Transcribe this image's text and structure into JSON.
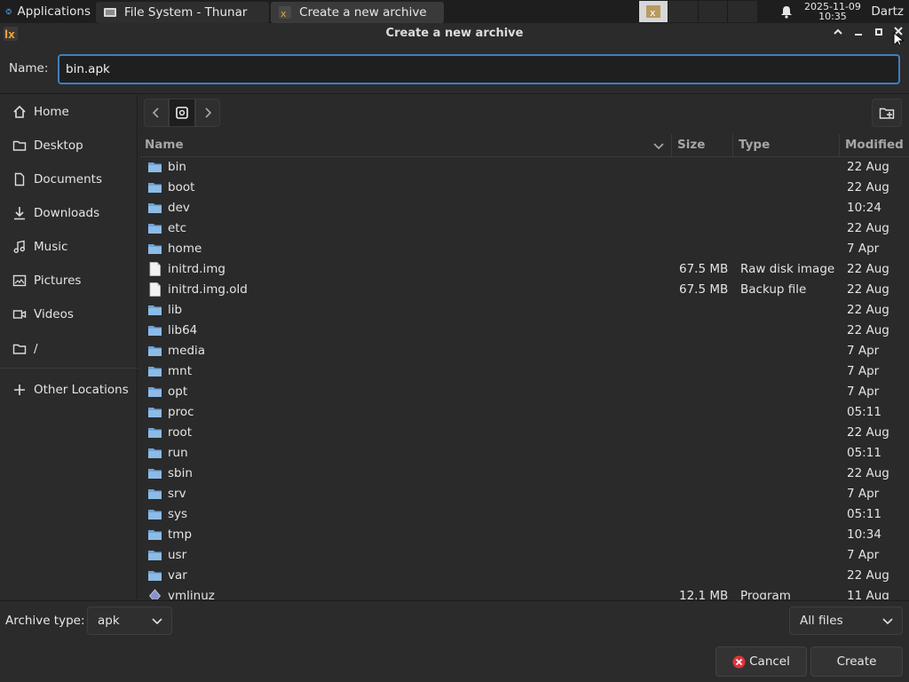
{
  "panel": {
    "applications_label": "Applications",
    "tasks": [
      {
        "label": "File System - Thunar"
      },
      {
        "label": "Create a new archive"
      }
    ],
    "clock_date": "2025-11-09",
    "clock_time": "10:35",
    "user": "Dartz"
  },
  "dialog": {
    "title": "Create a new archive",
    "name_label": "Name:",
    "name_value": "bin.apk"
  },
  "sidebar": {
    "items": [
      {
        "label": "Home",
        "icon": "home-icon"
      },
      {
        "label": "Desktop",
        "icon": "folder-icon"
      },
      {
        "label": "Documents",
        "icon": "document-icon"
      },
      {
        "label": "Downloads",
        "icon": "download-icon"
      },
      {
        "label": "Music",
        "icon": "music-icon"
      },
      {
        "label": "Pictures",
        "icon": "picture-icon"
      },
      {
        "label": "Videos",
        "icon": "video-icon"
      },
      {
        "label": "/",
        "icon": "folder-icon"
      },
      {
        "label": "Other Locations",
        "icon": "plus-icon"
      }
    ]
  },
  "columns": {
    "name": "Name",
    "size": "Size",
    "type": "Type",
    "modified": "Modified"
  },
  "files": [
    {
      "name": "bin",
      "kind": "folder",
      "size": "",
      "type": "",
      "modified": "22 Aug"
    },
    {
      "name": "boot",
      "kind": "folder",
      "size": "",
      "type": "",
      "modified": "22 Aug"
    },
    {
      "name": "dev",
      "kind": "folder",
      "size": "",
      "type": "",
      "modified": "10:24"
    },
    {
      "name": "etc",
      "kind": "folder",
      "size": "",
      "type": "",
      "modified": "22 Aug"
    },
    {
      "name": "home",
      "kind": "folder",
      "size": "",
      "type": "",
      "modified": "7 Apr"
    },
    {
      "name": "initrd.img",
      "kind": "file",
      "size": "67.5 MB",
      "type": "Raw disk image",
      "modified": "22 Aug"
    },
    {
      "name": "initrd.img.old",
      "kind": "file",
      "size": "67.5 MB",
      "type": "Backup file",
      "modified": "22 Aug"
    },
    {
      "name": "lib",
      "kind": "folder",
      "size": "",
      "type": "",
      "modified": "22 Aug"
    },
    {
      "name": "lib64",
      "kind": "folder",
      "size": "",
      "type": "",
      "modified": "22 Aug"
    },
    {
      "name": "media",
      "kind": "folder",
      "size": "",
      "type": "",
      "modified": "7 Apr"
    },
    {
      "name": "mnt",
      "kind": "folder",
      "size": "",
      "type": "",
      "modified": "7 Apr"
    },
    {
      "name": "opt",
      "kind": "folder",
      "size": "",
      "type": "",
      "modified": "7 Apr"
    },
    {
      "name": "proc",
      "kind": "folder",
      "size": "",
      "type": "",
      "modified": "05:11"
    },
    {
      "name": "root",
      "kind": "folder",
      "size": "",
      "type": "",
      "modified": "22 Aug"
    },
    {
      "name": "run",
      "kind": "folder",
      "size": "",
      "type": "",
      "modified": "05:11"
    },
    {
      "name": "sbin",
      "kind": "folder",
      "size": "",
      "type": "",
      "modified": "22 Aug"
    },
    {
      "name": "srv",
      "kind": "folder",
      "size": "",
      "type": "",
      "modified": "7 Apr"
    },
    {
      "name": "sys",
      "kind": "folder",
      "size": "",
      "type": "",
      "modified": "05:11"
    },
    {
      "name": "tmp",
      "kind": "folder",
      "size": "",
      "type": "",
      "modified": "10:34"
    },
    {
      "name": "usr",
      "kind": "folder",
      "size": "",
      "type": "",
      "modified": "7 Apr"
    },
    {
      "name": "var",
      "kind": "folder",
      "size": "",
      "type": "",
      "modified": "22 Aug"
    },
    {
      "name": "vmlinuz",
      "kind": "program",
      "size": "12.1 MB",
      "type": "Program",
      "modified": "11 Aug"
    }
  ],
  "bottom": {
    "archive_type_label": "Archive type:",
    "archive_type_value": "apk",
    "filter_value": "All files",
    "cancel_label": "Cancel",
    "create_label": "Create"
  },
  "colors": {
    "accent": "#3f7fbf",
    "folder": "#6fa3d8",
    "cancel_icon": "#e0343a"
  }
}
